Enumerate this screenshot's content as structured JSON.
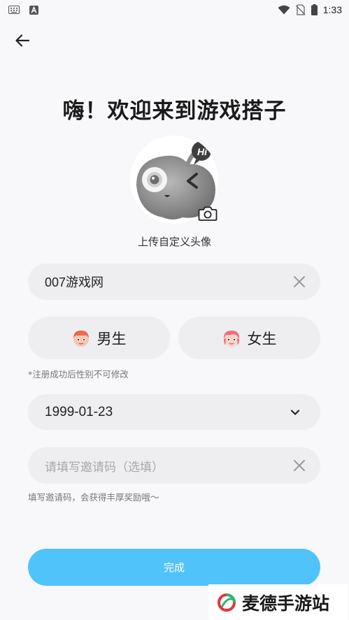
{
  "status_bar": {
    "time": "1:33",
    "icons": [
      "keyboard-icon",
      "a-notification-icon",
      "wifi-icon",
      "no-sim-icon",
      "battery-icon"
    ]
  },
  "title": "嗨！欢迎来到游戏搭子",
  "avatar": {
    "label": "上传自定义头像",
    "badge_text": "Hi"
  },
  "nickname": {
    "value": "007游戏网"
  },
  "gender": {
    "male_label": "男生",
    "female_label": "女生",
    "note": "*注册成功后性别不可修改"
  },
  "birthday": {
    "value": "1999-01-23"
  },
  "invite": {
    "placeholder": "请填写邀请码（选填）",
    "note": "填写邀请码，会获得丰厚奖励哦～"
  },
  "submit_label": "完成",
  "watermark": {
    "text": "麦德手游站"
  },
  "colors": {
    "accent": "#4fc3fa",
    "field_bg": "#eeeef0",
    "page_bg": "#f8f8fa"
  }
}
